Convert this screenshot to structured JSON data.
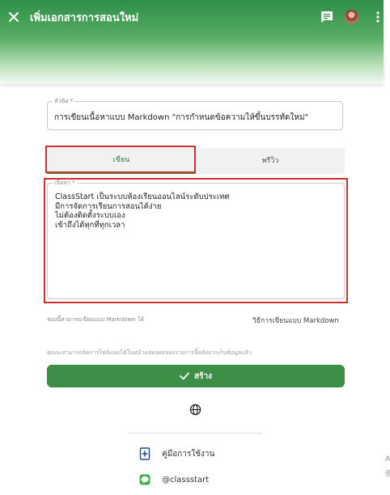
{
  "header": {
    "title": "เพิ่มเอกสารการสอนใหม่",
    "close_icon": "close-icon",
    "chat_icon": "chat-icon",
    "more_icon": "more-vert-icon"
  },
  "form": {
    "title_label": "หัวข้อ *",
    "title_value": "การเขียนเนื้อหาแบบ Markdown \"การกำหนดข้อความให้ขึ้นบรรทัดใหม่\"",
    "tabs": {
      "write": "เขียน",
      "preview": "พรีวิว"
    },
    "content_label": "เนื้อหา *",
    "content_lines": [
      "ClassStart เป็นระบบห้องเรียนออนไลน์ระดับประเทศ",
      "มีการจัดการเรียนการสอนได้ง่าย",
      "ไม่ต้องติดตั้งระบบเอง",
      "เข้าถึงได้ทุกที่ทุกเวลา"
    ],
    "markdown_hint": "ช่องนี้สามารถเขียนแบบ Markdown ได้",
    "markdown_link": "วิธีการเขียนแบบ Markdown",
    "files_note": "คุณจะสามารถจัดการไฟล์แนบได้ในหน้าแสดงผลของรายการนี้หลังจากเก็บข้อมูลแล้ว",
    "create_label": "สร้าง"
  },
  "footer": {
    "guide_label": "คู่มือการใช้งาน",
    "line_label": "@classstart"
  },
  "colors": {
    "accent": "#3d8f47",
    "highlight": "#d0312d"
  }
}
